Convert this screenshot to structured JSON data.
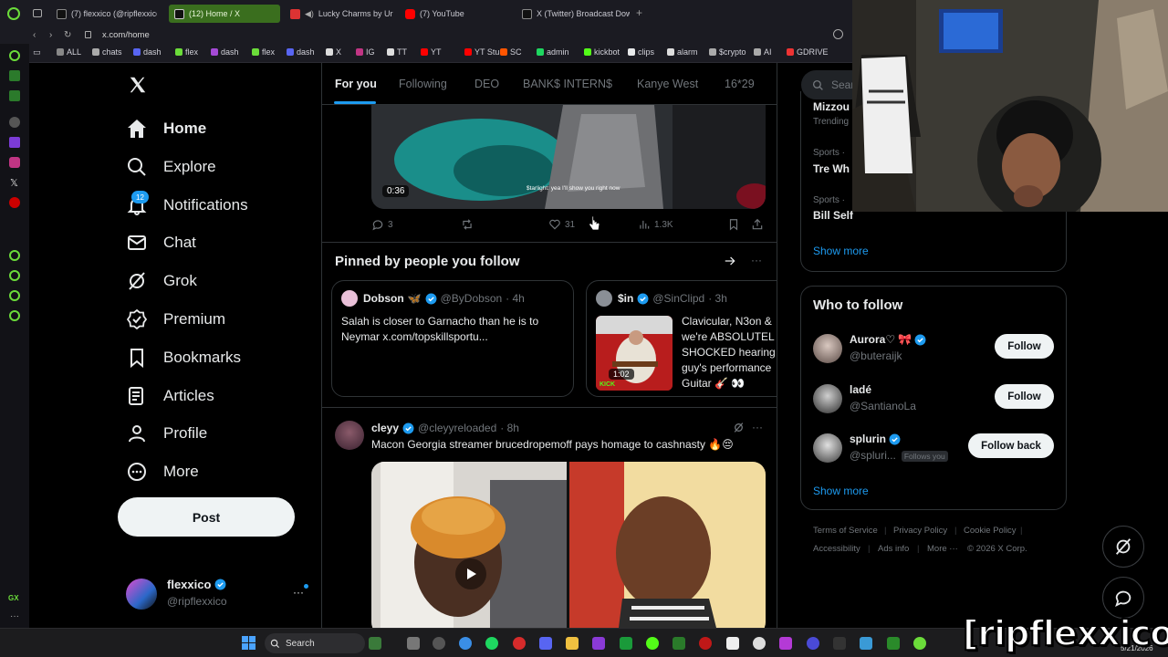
{
  "browser": {
    "tabs": [
      {
        "label": "(7) flexxico (@ripflexxico)",
        "color": "#e7e9ea"
      },
      {
        "label": "(12) Home / X",
        "color": "#e7e9ea"
      },
      {
        "label": "Lucky Charms by Ur",
        "color": "#ff4444"
      },
      {
        "label": "(7) YouTube",
        "color": "#ff0000"
      },
      {
        "label": "X (Twitter) Broadcast Down",
        "color": "#e7e9ea"
      }
    ],
    "url": "x.com/home",
    "bookmarks": [
      "ALL",
      "chats",
      "dash",
      "flex",
      "dash",
      "flex",
      "dash",
      "X",
      "IG",
      "TT",
      "YT",
      "YT Stu",
      "SC",
      "admin",
      "kickbot",
      "clips",
      "alarm",
      "$crypto",
      "AI",
      "GDRIVE"
    ]
  },
  "nav": {
    "items": [
      {
        "label": "Home",
        "icon": "home-icon"
      },
      {
        "label": "Explore",
        "icon": "search-icon"
      },
      {
        "label": "Notifications",
        "icon": "bell-icon"
      },
      {
        "label": "Chat",
        "icon": "mail-icon"
      },
      {
        "label": "Grok",
        "icon": "grok-icon"
      },
      {
        "label": "Premium",
        "icon": "premium-icon"
      },
      {
        "label": "Bookmarks",
        "icon": "bookmark-icon"
      },
      {
        "label": "Articles",
        "icon": "articles-icon"
      },
      {
        "label": "Profile",
        "icon": "person-icon"
      },
      {
        "label": "More",
        "icon": "more-circle-icon"
      }
    ],
    "notifications_count": "12",
    "post_label": "Post",
    "account": {
      "name": "flexxico",
      "handle": "@ripflexxico"
    }
  },
  "timeline": {
    "tabs": [
      "For you",
      "Following",
      "DEO",
      "BANK$ INTERN$",
      "Kanye West",
      "16*29"
    ],
    "video_post": {
      "duration": "0:36",
      "caption": "$tarlight: yea I'll show you right now",
      "replies": "3",
      "likes": "31",
      "views": "1.3K"
    },
    "pinned": {
      "title": "Pinned by people you follow",
      "cards": [
        {
          "name": "Dobson",
          "emoji": "🦋",
          "handle": "@ByDobson",
          "time": "· 4h",
          "text": "Salah is closer to Garnacho than he is to Neymar x.com/topskillsportu..."
        },
        {
          "name": "$in",
          "handle": "@SinClipd",
          "time": "· 3h",
          "text": "Clavicular, N3on & we're ABSOLUTEL SHOCKED hearing guy's performance Guitar 🎸 👀",
          "duration": "1:02",
          "tag": "KICK"
        }
      ]
    },
    "post": {
      "name": "cleyy",
      "handle": "@cleyyreloaded",
      "time": "· 8h",
      "text": "Macon Georgia streamer brucedropemoff pays homage to cashnasty 🔥😔"
    }
  },
  "right": {
    "search_placeholder": "Searc",
    "trends": [
      {
        "category": "",
        "name": "Mizzou",
        "sub": "Trending"
      },
      {
        "category": "Sports ·",
        "name": "Tre Wh"
      },
      {
        "category": "Sports ·",
        "name": "Bill Self"
      }
    ],
    "show_more": "Show more",
    "who_to_follow": {
      "title": "Who to follow",
      "users": [
        {
          "name": "Aurora♡ 🎀",
          "handle": "@buteraijk",
          "button": "Follow"
        },
        {
          "name": "ladé",
          "handle": "@SantianoLa",
          "button": "Follow"
        },
        {
          "name": "splurin",
          "handle": "@spluri...",
          "follows_you": "Follows you",
          "button": "Follow back"
        }
      ],
      "show_more": "Show more"
    },
    "footer": [
      "Terms of Service",
      "Privacy Policy",
      "Cookie Policy",
      "Accessibility",
      "Ads info",
      "More ···",
      "© 2026 X Corp."
    ]
  },
  "taskbar": {
    "search": "Search",
    "date": "5/21/2026"
  },
  "stream": {
    "watermark": "[ripflexxico]"
  },
  "colors": {
    "accent": "#1d9bf0",
    "opera_green": "#6bdc3a",
    "bg": "#000000"
  }
}
